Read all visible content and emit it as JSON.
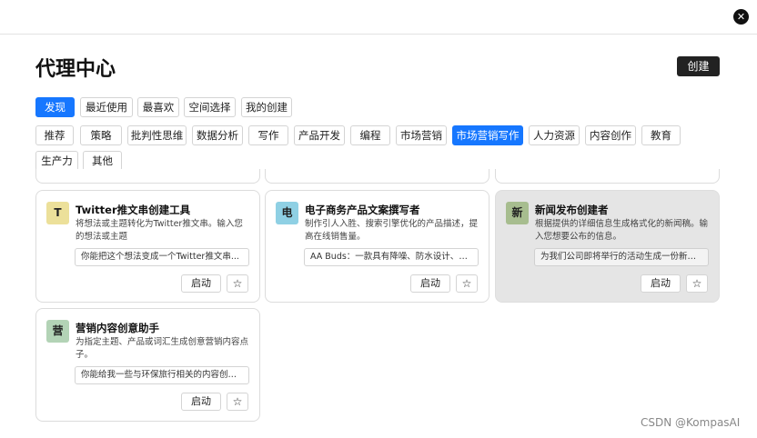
{
  "header": {
    "close_glyph": "✕",
    "close_icon": "close-icon"
  },
  "page": {
    "title": "代理中心",
    "create_label": "创建"
  },
  "primary_tabs": [
    {
      "label": "发现",
      "active": true
    },
    {
      "label": "最近使用",
      "active": false
    },
    {
      "label": "最喜欢",
      "active": false
    },
    {
      "label": "空间选择",
      "active": false
    },
    {
      "label": "我的创建",
      "active": false
    }
  ],
  "categories": [
    {
      "label": "推荐",
      "active": false
    },
    {
      "label": "策略",
      "active": false
    },
    {
      "label": "批判性思维",
      "active": false
    },
    {
      "label": "数据分析",
      "active": false
    },
    {
      "label": "写作",
      "active": false
    },
    {
      "label": "产品开发",
      "active": false
    },
    {
      "label": "编程",
      "active": false
    },
    {
      "label": "市场营销",
      "active": false
    },
    {
      "label": "市场营销写作",
      "active": true
    },
    {
      "label": "人力资源",
      "active": false
    },
    {
      "label": "内容创作",
      "active": false
    },
    {
      "label": "教育",
      "active": false
    },
    {
      "label": "生产力",
      "active": false
    },
    {
      "label": "其他",
      "active": false
    }
  ],
  "cards": [
    {
      "avatar": "T",
      "avatar_color": "#ece09a",
      "title": "Twitter推文串创建工具",
      "description": "将想法或主题转化为Twitter推文串。输入您的想法或主题",
      "input_value": "你能把这个想法变成一个Twitter推文串...",
      "launch_label": "启动",
      "star_glyph": "☆",
      "highlighted": false
    },
    {
      "avatar": "电",
      "avatar_color": "#8fd0e4",
      "title": "电子商务产品文案撰写者",
      "description": "制作引人入胜、搜索引擎优化的产品描述，提高在线销售量。",
      "input_value": "AA Buds：一款具有降噪、防水设计、高...",
      "launch_label": "启动",
      "star_glyph": "☆",
      "highlighted": false
    },
    {
      "avatar": "新",
      "avatar_color": "#a7bd8f",
      "title": "新闻发布创建者",
      "description": "根据提供的详细信息生成格式化的新闻稿。输入您想要公布的信息。",
      "input_value": "为我们公司即将举行的活动生成一份新闻...",
      "launch_label": "启动",
      "star_glyph": "☆",
      "highlighted": true
    },
    {
      "avatar": "营",
      "avatar_color": "#b3d3b6",
      "title": "营销内容创意助手",
      "description": "为指定主题、产品或词汇生成创意营销内容点子。",
      "input_value": "你能给我一些与环保旅行相关的内容创意...",
      "launch_label": "启动",
      "star_glyph": "☆",
      "highlighted": false
    }
  ],
  "watermark": "CSDN @KompasAI"
}
